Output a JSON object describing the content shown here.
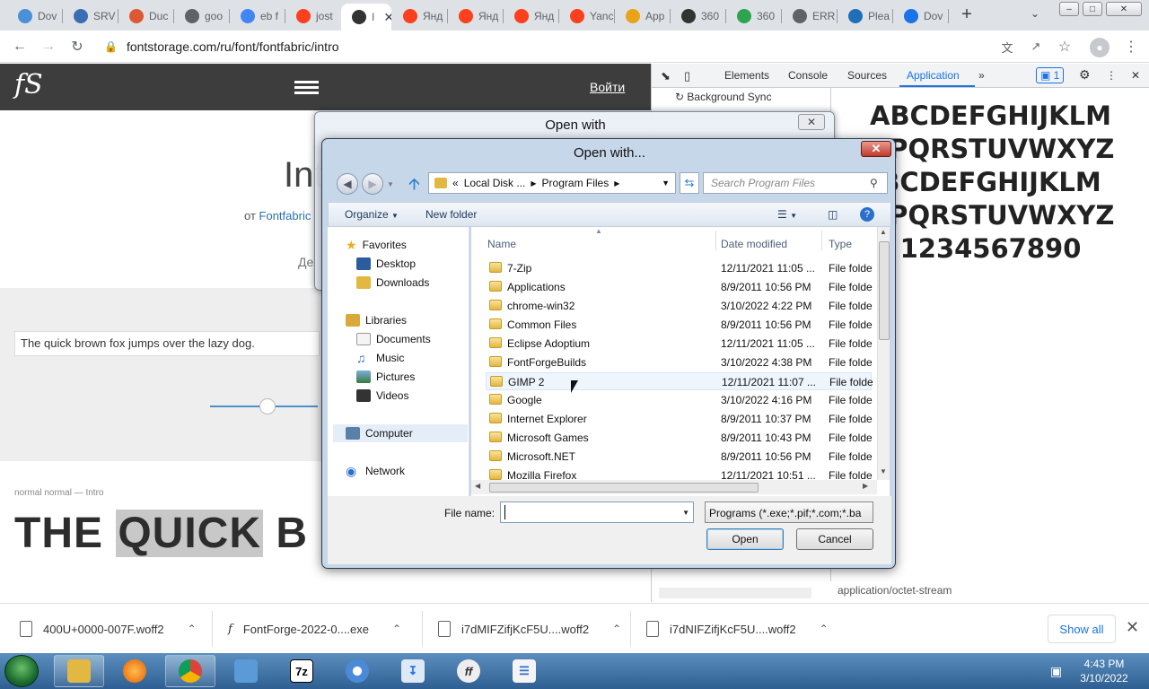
{
  "browser": {
    "tabs": [
      {
        "label": "Dov",
        "color": "#4a90d9"
      },
      {
        "label": "SRV",
        "color": "#3b6db5"
      },
      {
        "label": "Duc",
        "color": "#de5833"
      },
      {
        "label": "goo",
        "color": "#5f6368"
      },
      {
        "label": "eb f",
        "color": "#4285f4"
      },
      {
        "label": "jost",
        "color": "#fc3f1d"
      },
      {
        "label": "I",
        "color": "#333333",
        "active": true
      },
      {
        "label": "Янд",
        "color": "#fc3f1d"
      },
      {
        "label": "Янд",
        "color": "#fc3f1d"
      },
      {
        "label": "Янд",
        "color": "#fc3f1d"
      },
      {
        "label": "Yanc",
        "color": "#fc3f1d"
      },
      {
        "label": "App",
        "color": "#e8a317"
      },
      {
        "label": "360",
        "color": "#333333"
      },
      {
        "label": "360",
        "color": "#2da44e"
      },
      {
        "label": "ERR",
        "color": "#5f6368"
      },
      {
        "label": "Plea",
        "color": "#1e6fb8"
      },
      {
        "label": "Dov",
        "color": "#1a73e8"
      }
    ],
    "url": "fontstorage.com/ru/font/fontfabric/intro"
  },
  "site": {
    "logo": "fS",
    "login": "Войти",
    "title": "Int",
    "byline_prefix": "от",
    "byline_link": "Fontfabric",
    "de_text": "Де",
    "sample_text": "The quick brown fox jumps over the lazy dog.",
    "meta": "normal normal — Intro",
    "big_text_a": "THE ",
    "big_text_b": "QUICK",
    "big_text_c": " B"
  },
  "devtools": {
    "tabs": [
      "Elements",
      "Console",
      "Sources",
      "Application"
    ],
    "active_tab": "Application",
    "issues_count": "1",
    "sidebar_item": "Background Sync",
    "preview_lines": [
      "ABCDEFGHIJKLM",
      "OPQRSTUVWXYZ",
      "BCDEFGHIJKLM",
      "OPQRSTUVWXYZ",
      "1234567890"
    ],
    "mime": "application/octet-stream"
  },
  "dialog_back": {
    "title": "Open with"
  },
  "dialog": {
    "title": "Open with...",
    "breadcrumb": [
      "«",
      "Local Disk ...",
      "Program Files"
    ],
    "search_placeholder": "Search Program Files",
    "organize": "Organize",
    "new_folder": "New folder",
    "nav": {
      "favorites": "Favorites",
      "desktop": "Desktop",
      "downloads": "Downloads",
      "libraries": "Libraries",
      "documents": "Documents",
      "music": "Music",
      "pictures": "Pictures",
      "videos": "Videos",
      "computer": "Computer",
      "network": "Network"
    },
    "columns": {
      "name": "Name",
      "date": "Date modified",
      "type": "Type"
    },
    "files": [
      {
        "name": "7-Zip",
        "date": "12/11/2021 11:05 ...",
        "type": "File folde"
      },
      {
        "name": "Applications",
        "date": "8/9/2011 10:56 PM",
        "type": "File folde"
      },
      {
        "name": "chrome-win32",
        "date": "3/10/2022 4:22 PM",
        "type": "File folde"
      },
      {
        "name": "Common Files",
        "date": "8/9/2011 10:56 PM",
        "type": "File folde"
      },
      {
        "name": "Eclipse Adoptium",
        "date": "12/11/2021 11:05 ...",
        "type": "File folde"
      },
      {
        "name": "FontForgeBuilds",
        "date": "3/10/2022 4:38 PM",
        "type": "File folde"
      },
      {
        "name": "GIMP 2",
        "date": "12/11/2021 11:07 ...",
        "type": "File folde"
      },
      {
        "name": "Google",
        "date": "3/10/2022 4:16 PM",
        "type": "File folde"
      },
      {
        "name": "Internet Explorer",
        "date": "8/9/2011 10:37 PM",
        "type": "File folde"
      },
      {
        "name": "Microsoft Games",
        "date": "8/9/2011 10:43 PM",
        "type": "File folde"
      },
      {
        "name": "Microsoft.NET",
        "date": "8/9/2011 10:56 PM",
        "type": "File folde"
      },
      {
        "name": "Mozilla Firefox",
        "date": "12/11/2021 10:51 ...",
        "type": "File folde"
      }
    ],
    "file_name_label": "File name:",
    "file_name_value": "",
    "file_type": "Programs (*.exe;*.pif;*.com;*.ba",
    "open": "Open",
    "cancel": "Cancel"
  },
  "downloads": {
    "items": [
      "400U+0000-007F.woff2",
      "FontForge-2022-0....exe",
      "i7dMIFZifjKcF5U....woff2",
      "i7dNIFZifjKcF5U....woff2"
    ],
    "show_all": "Show all"
  },
  "taskbar": {
    "time": "4:43 PM",
    "date": "3/10/2022"
  }
}
